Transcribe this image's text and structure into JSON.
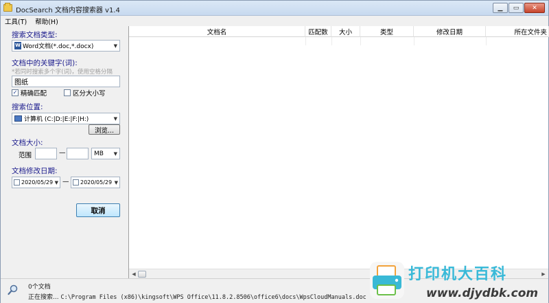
{
  "window": {
    "title": "DocSearch 文档内容搜索器 v1.4"
  },
  "menu": {
    "tools": "工具(T)",
    "help": "帮助(H)"
  },
  "left_panel": {
    "doc_type_label": "搜索文档类型:",
    "doc_type_value": "Word文档(*.doc,*.docx)",
    "keyword_label": "文档中的关键字(词):",
    "keyword_hint": "*若同时搜索多个字(词)，使用空格分隔",
    "keyword_value": "图纸",
    "exact_match_label": "精确匹配",
    "exact_match_checked": true,
    "case_sensitive_label": "区分大小写",
    "case_sensitive_checked": false,
    "location_label": "搜索位置:",
    "location_value": "计算机 (C:|D:|E:|F:|H:)",
    "browse_button": "浏览...",
    "size_label": "文档大小:",
    "size_range_label": "范围",
    "size_dash": "—",
    "size_unit": "MB",
    "date_label": "文档修改日期:",
    "date_from": "2020/05/29",
    "date_to": "2020/05/29",
    "date_dash": "—",
    "cancel_button": "取消"
  },
  "results": {
    "columns": [
      "文档名",
      "匹配数",
      "大小",
      "类型",
      "修改日期",
      "所在文件夹"
    ],
    "rows": []
  },
  "status": {
    "count": "0个文档",
    "searching_prefix": "正在搜索...",
    "searching_path": "C:\\Program Files (x86)\\kingsoft\\WPS Office\\11.8.2.8506\\office6\\docs\\WpsCloudManuals.doc"
  },
  "watermark": {
    "title": "打印机大百科",
    "url": "www.djydbk.com"
  },
  "colors": {
    "accent_label": "#1a1a8c",
    "watermark_blue": "#38b9d8",
    "close_button": "#c7442b"
  }
}
